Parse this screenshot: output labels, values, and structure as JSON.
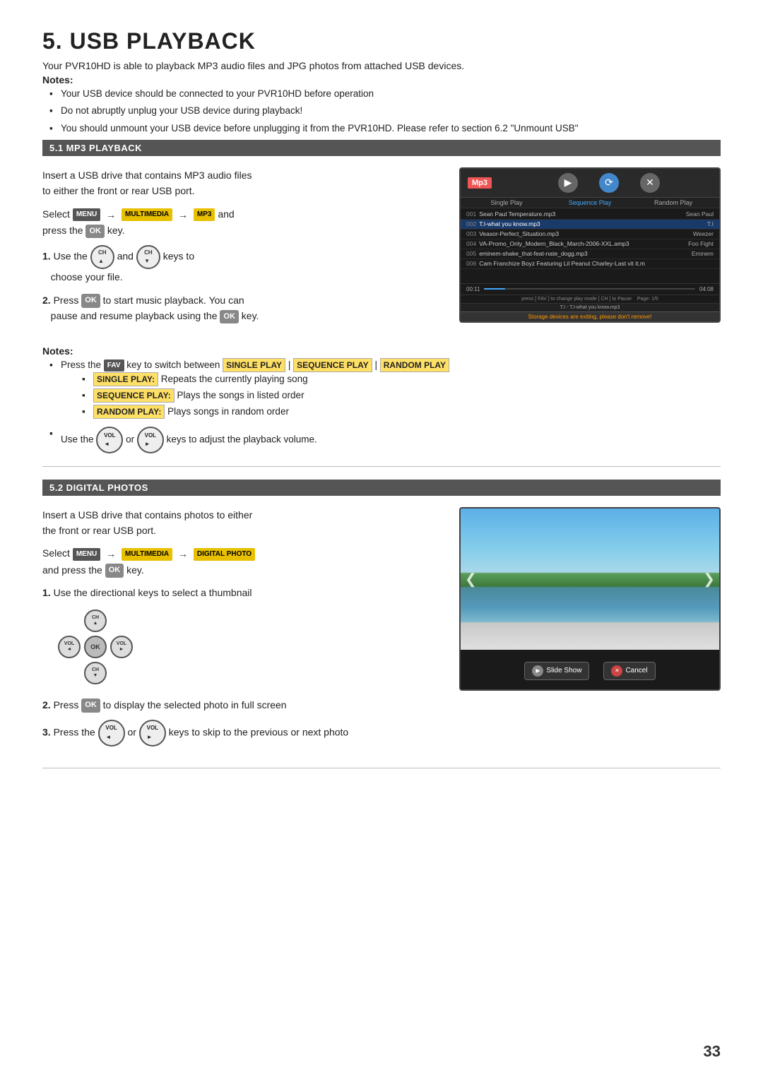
{
  "page": {
    "number": "33",
    "title": "5. USB PLAYBACK",
    "intro": "Your PVR10HD is able to playback MP3 audio files and JPG photos from attached USB devices."
  },
  "notes_intro": {
    "label": "Notes:",
    "bullets": [
      "Your USB device should be connected to your PVR10HD before operation",
      "Do not abruptly unplug your USB device during playback!",
      "You should unmount your USB device before unplugging it from the PVR10HD. Please refer to section 6.2 \"Unmount USB\""
    ]
  },
  "section51": {
    "header": "5.1 MP3 PLAYBACK",
    "para1": "Insert a USB drive that contains MP3 audio files",
    "para2": "to either the front or rear USB port.",
    "select_text": "Select",
    "menu_key": "MENU",
    "arrow": "→",
    "multimedia_key": "MULTIMEDIA",
    "mp3_key": "MP3",
    "and_text": "and",
    "press_text": "press the",
    "ok_key": "OK",
    "key_text": "key.",
    "step1_label": "1.",
    "step1_text": "Use the",
    "ch_up": "CH▲",
    "and_text2": "and",
    "ch_down": "CH▼",
    "step1_text2": "keys to",
    "step1_text3": "choose your file.",
    "step2_label": "2.",
    "step2_text": "Press",
    "step2_ok": "OK",
    "step2_text2": "to start music playback. You can",
    "step2_text3": "pause and resume playback using the",
    "step2_ok2": "OK",
    "step2_text4": "key.",
    "notes_label": "Notes:",
    "notes_fav": "Press the",
    "fav_key": "FAV",
    "notes_fav2": "key to switch between",
    "single_play": "SINGLE PLAY",
    "pipe": "|",
    "sequence_play": "SEQUENCE PLAY",
    "pipe2": "|",
    "random_play": "RANDOM PLAY",
    "sub_bullets": [
      {
        "label": "SINGLE PLAY:",
        "text": "Repeats the currently playing song"
      },
      {
        "label": "SEQUENCE PLAY:",
        "text": "Plays the songs in listed order"
      },
      {
        "label": "RANDOM PLAY:",
        "text": "Plays songs in random order"
      }
    ],
    "vol_text1": "Use the",
    "vol_left": "VOL◄",
    "or_text": "or",
    "vol_right": "VOL►",
    "vol_text2": "keys to adjust the playback volume.",
    "screen": {
      "mp3_label": "Mp3",
      "play_modes": [
        "Single Play",
        "Sequence Play",
        "Random Play"
      ],
      "active_mode": 1,
      "tracks": [
        {
          "num": "001",
          "name": "Sean Paul Temperature.mp3",
          "artist": "Sean Paul"
        },
        {
          "num": "002",
          "name": "T.I-what you know.mp3",
          "artist": "T.I",
          "highlighted": true
        },
        {
          "num": "003",
          "name": "Veasor-Perfect_Situation.mp3",
          "artist": "Weezer"
        },
        {
          "num": "004",
          "name": "VA-Promo_Only_Modern_Black_March-2006-XXL.amp3",
          "artist": "Foo Fight"
        },
        {
          "num": "005",
          "name": "eminem-shake_that-feat-nate_dogg.mp3",
          "artist": "Eminem"
        },
        {
          "num": "006",
          "name": "Cam Franchize Boyz Featuring Lil Peanut Charley-Last vit it.m",
          "artist": ""
        }
      ],
      "footer_left": "00:11",
      "footer_right": "04:08",
      "page_info": "Page: 1/5",
      "now_playing": "T.I - T.I-what you know.mp3",
      "storage_warning": "Storage devices are exiting, please don't remove!",
      "nav_hint": "press [ FAV ] to change play mode  [ CH ] to Pause"
    }
  },
  "section52": {
    "header": "5.2 DIGITAL PHOTOS",
    "para1": "Insert a USB drive that contains photos to either",
    "para2": "the front or rear USB port.",
    "select_text": "Select",
    "menu_key": "MENU",
    "arrow": "→",
    "multimedia_key": "MULTIMEDIA",
    "arrow2": "→",
    "digital_photo_key": "DIGITAL PHOTO",
    "and_press": "and press the",
    "ok_key": "OK",
    "key_text": "key.",
    "step1_label": "1.",
    "step1_text": "Use the directional keys to select a thumbnail",
    "step2_label": "2.",
    "step2_text": "Press",
    "step2_ok": "OK",
    "step2_text2": "to display the selected photo in full screen",
    "step3_label": "3.",
    "step3_text": "Press the",
    "step3_vol_left": "VOL◄",
    "step3_or": "or",
    "step3_vol_right": "VOL►",
    "step3_text2": "keys to skip to the previous or next photo",
    "photo_btn1": "Slide Show",
    "photo_btn2": "Cancel"
  }
}
